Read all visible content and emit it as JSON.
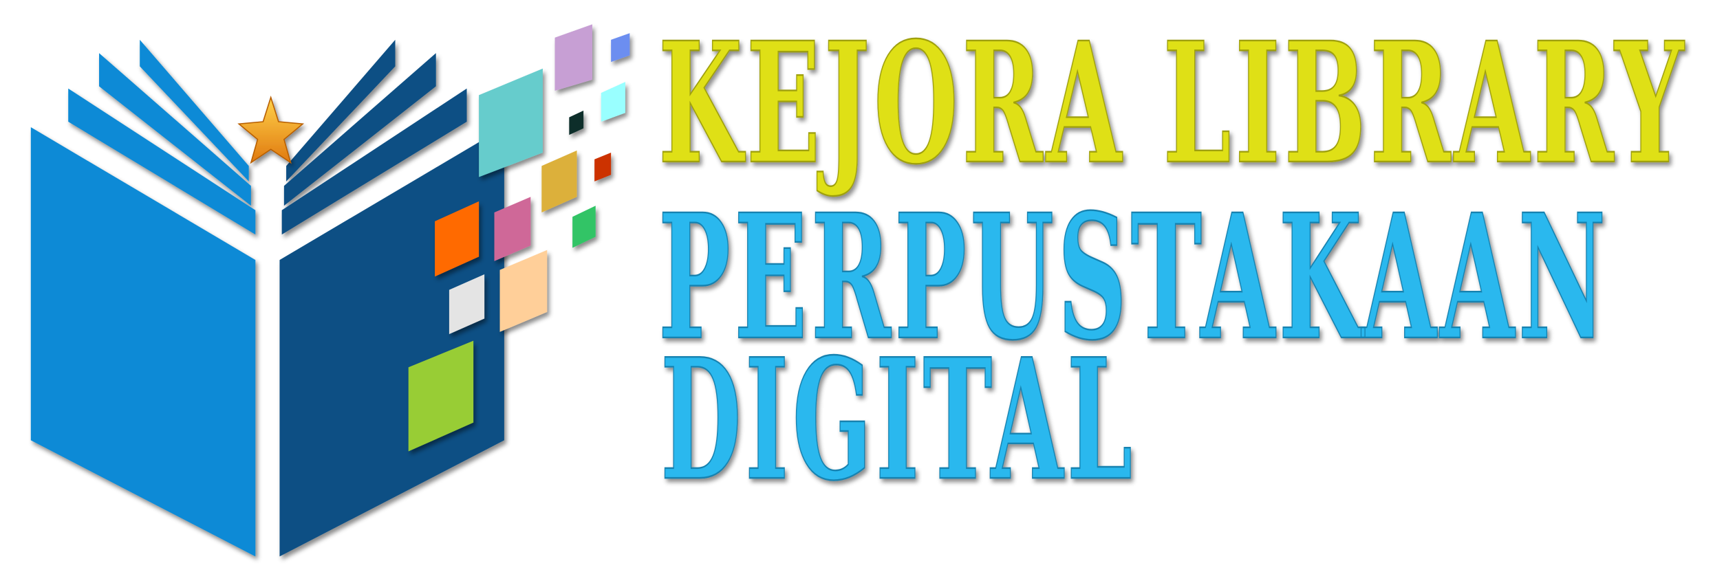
{
  "logo": {
    "line1": "KEJORA  LIBRARY",
    "line2": "PERPUSTAKAAN",
    "line3": "DIGITAL",
    "icon": "open-book-icon",
    "star_icon": "star-icon",
    "colors": {
      "title_yellow": "#dfe015",
      "title_blue": "#2bb8ee",
      "book_left": "#0a8ad6",
      "book_right": "#0b4f84",
      "star": "#f5a623"
    }
  }
}
